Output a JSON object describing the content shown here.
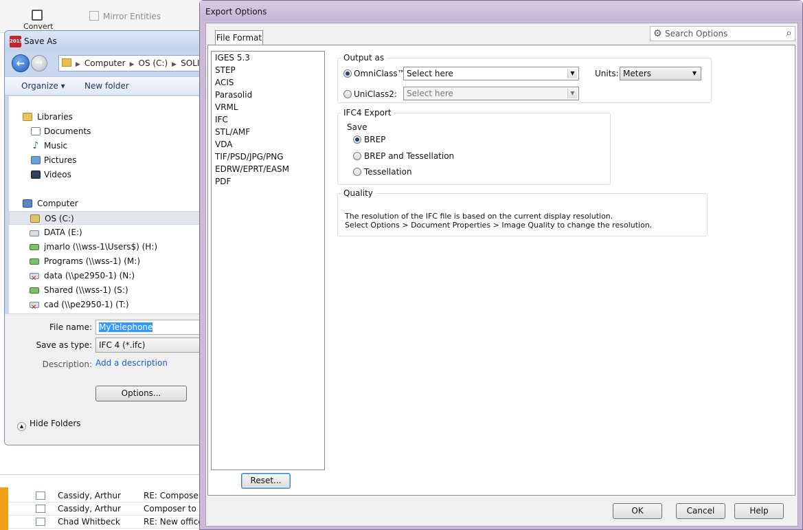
{
  "background_app": {
    "convert_label": "Convert",
    "mirror_label": "Mirror Entities"
  },
  "save_as": {
    "title": "Save As",
    "icon_text": "2015",
    "address": [
      "Computer",
      "OS (C:)",
      "SOLID"
    ],
    "organize_label": "Organize ▾",
    "new_folder_label": "New folder",
    "nav": {
      "libraries": "Libraries",
      "documents": "Documents",
      "music": "Music",
      "pictures": "Pictures",
      "videos": "Videos",
      "computer": "Computer",
      "drives": [
        {
          "label": "OS (C:)",
          "icon": "drive-icon",
          "selected": true
        },
        {
          "label": "DATA (E:)",
          "icon": "drive-icon"
        },
        {
          "label": "jmarlo (\\\\wss-1\\Users$) (H:)",
          "icon": "network-drive-icon"
        },
        {
          "label": "Programs (\\\\wss-1) (M:)",
          "icon": "network-drive-icon"
        },
        {
          "label": "data (\\\\pe2950-1) (N:)",
          "icon": "disconnected-drive-icon"
        },
        {
          "label": "Shared (\\\\wss-1) (S:)",
          "icon": "network-drive-icon"
        },
        {
          "label": "cad (\\\\pe2950-1) (T:)",
          "icon": "disconnected-drive-icon"
        }
      ]
    },
    "file_name_label": "File name:",
    "file_name_value": "MyTelephone",
    "save_type_label": "Save as type:",
    "save_type_value": "IFC 4 (*.ifc)",
    "description_label": "Description:",
    "description_link": "Add a description",
    "options_button": "Options...",
    "hide_folders": "Hide Folders"
  },
  "email_list": [
    {
      "from": "Cassidy, Arthur",
      "subject": "RE: Composer to"
    },
    {
      "from": "Cassidy, Arthur",
      "subject": "Composer to Co"
    },
    {
      "from": "Chad Whitbeck",
      "subject": "RE: New office p"
    }
  ],
  "export": {
    "title": "Export Options",
    "tab": "File Format",
    "search_placeholder": "Search Options",
    "formats": [
      "IGES 5.3",
      "STEP",
      "ACIS",
      "Parasolid",
      "VRML",
      "IFC",
      "STL/AMF",
      "VDA",
      "TIF/PSD/JPG/PNG",
      "EDRW/EPRT/EASM",
      "PDF"
    ],
    "selected_format": "IFC",
    "reset_button": "Reset...",
    "output_as": {
      "label": "Output as",
      "omniclass_label": "OmniClass™:",
      "omniclass_value": "Select here",
      "omniclass_selected": true,
      "uniclass_label": "UniClass2:",
      "uniclass_value": "Select here",
      "units_label": "Units:",
      "units_value": "Meters"
    },
    "ifc4": {
      "label": "IFC4 Export",
      "save_label": "Save",
      "options": [
        {
          "label": "BREP",
          "selected": true
        },
        {
          "label": "BREP and Tessellation",
          "selected": false
        },
        {
          "label": "Tessellation",
          "selected": false
        }
      ]
    },
    "quality": {
      "label": "Quality",
      "line1": "The resolution of the IFC file is based on the current display resolution.",
      "line2": "Select Options > Document Properties > Image Quality to change the resolution."
    },
    "buttons": {
      "ok": "OK",
      "cancel": "Cancel",
      "help": "Help"
    }
  }
}
